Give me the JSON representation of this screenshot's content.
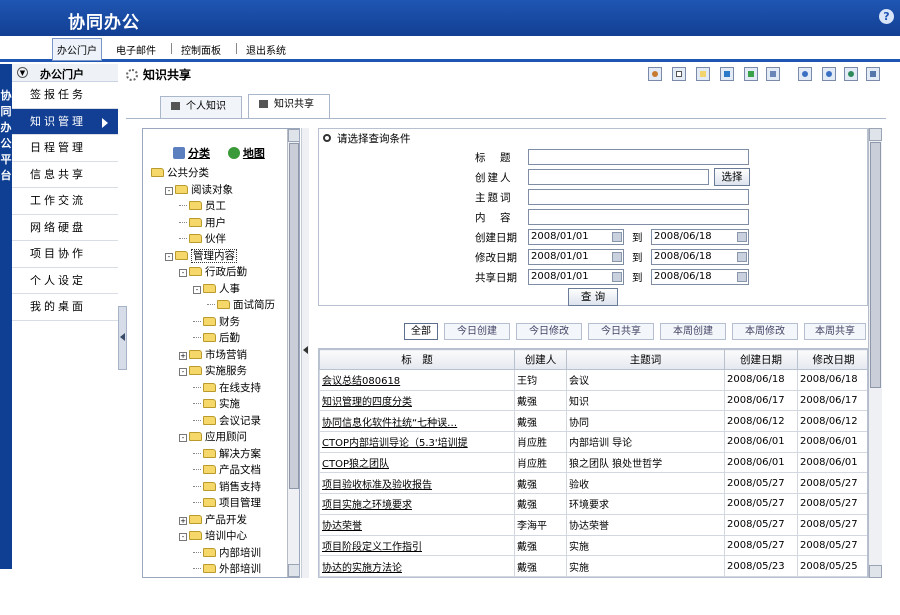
{
  "app": {
    "title": "协同办公"
  },
  "menu": [
    {
      "label": "办公门户",
      "active": true
    },
    {
      "label": "电子邮件"
    },
    {
      "label": "控制面板"
    },
    {
      "label": "退出系统"
    }
  ],
  "strip_text": "协同办公平台",
  "nav": {
    "header": "办公门户",
    "items": [
      {
        "label": "签报任务"
      },
      {
        "label": "知识管理",
        "active": true
      },
      {
        "label": "日程管理"
      },
      {
        "label": "信息共享"
      },
      {
        "label": "工作交流"
      },
      {
        "label": "网络硬盘"
      },
      {
        "label": "项目协作"
      },
      {
        "label": "个人设定"
      },
      {
        "label": "我的桌面"
      }
    ]
  },
  "page": {
    "title": "知识共享"
  },
  "toolbar_icons": [
    "user-icon",
    "document-icon",
    "copy-icon",
    "monitor-icon",
    "edit-icon",
    "back-icon",
    "prev-icon",
    "next-icon",
    "refresh-icon",
    "settings-icon"
  ],
  "tabs": [
    {
      "label": "个人知识"
    },
    {
      "label": "知识共享",
      "active": true
    }
  ],
  "tree": {
    "top_links": [
      "分类",
      "地图"
    ],
    "nodes": [
      {
        "label": "公共分类",
        "level": 0,
        "exp": ""
      },
      {
        "label": "阅读对象",
        "level": 1,
        "exp": "-"
      },
      {
        "label": "员工",
        "level": 2,
        "exp": ""
      },
      {
        "label": "用户",
        "level": 2,
        "exp": ""
      },
      {
        "label": "伙伴",
        "level": 2,
        "exp": ""
      },
      {
        "label": "管理内容",
        "level": 1,
        "exp": "-",
        "sel": true
      },
      {
        "label": "行政后勤",
        "level": 2,
        "exp": "-"
      },
      {
        "label": "人事",
        "level": 3,
        "exp": "-"
      },
      {
        "label": "面试简历",
        "level": 4,
        "exp": ""
      },
      {
        "label": "财务",
        "level": 3,
        "exp": ""
      },
      {
        "label": "后勤",
        "level": 3,
        "exp": ""
      },
      {
        "label": "市场营销",
        "level": 2,
        "exp": "+"
      },
      {
        "label": "实施服务",
        "level": 2,
        "exp": "-"
      },
      {
        "label": "在线支持",
        "level": 3,
        "exp": ""
      },
      {
        "label": "实施",
        "level": 3,
        "exp": ""
      },
      {
        "label": "会议记录",
        "level": 3,
        "exp": ""
      },
      {
        "label": "应用顾问",
        "level": 2,
        "exp": "-"
      },
      {
        "label": "解决方案",
        "level": 3,
        "exp": ""
      },
      {
        "label": "产品文档",
        "level": 3,
        "exp": ""
      },
      {
        "label": "销售支持",
        "level": 3,
        "exp": ""
      },
      {
        "label": "项目管理",
        "level": 3,
        "exp": ""
      },
      {
        "label": "产品开发",
        "level": 2,
        "exp": "+"
      },
      {
        "label": "培训中心",
        "level": 2,
        "exp": "-"
      },
      {
        "label": "内部培训",
        "level": 3,
        "exp": ""
      },
      {
        "label": "外部培训",
        "level": 3,
        "exp": ""
      }
    ]
  },
  "query": {
    "header": "请选择查询条件",
    "fields": {
      "title_label": "标　题",
      "creator_label": "创建人",
      "topic_label": "主题词",
      "content_label": "内　容",
      "created_label": "创建日期",
      "modified_label": "修改日期",
      "shared_label": "共享日期",
      "to_label": "到",
      "select_button": "选择",
      "query_button": "查 询",
      "created_from": "2008/01/01",
      "created_to": "2008/06/18",
      "modified_from": "2008/01/01",
      "modified_to": "2008/06/18",
      "shared_from": "2008/01/01",
      "shared_to": "2008/06/18"
    }
  },
  "filters": [
    {
      "label": "全部",
      "active": true
    },
    {
      "label": "今日创建"
    },
    {
      "label": "今日修改"
    },
    {
      "label": "今日共享"
    },
    {
      "label": "本周创建"
    },
    {
      "label": "本周修改"
    },
    {
      "label": "本周共享"
    }
  ],
  "grid": {
    "columns": [
      "标　题",
      "创建人",
      "主题词",
      "创建日期",
      "修改日期"
    ],
    "rows": [
      [
        "会议总结080618",
        "王钧",
        "会议",
        "2008/06/18",
        "2008/06/18"
      ],
      [
        "知识管理的四度分类",
        "戴强",
        "知识",
        "2008/06/17",
        "2008/06/17"
      ],
      [
        "协同信息化软件社统“七种误…",
        "戴强",
        "协同",
        "2008/06/12",
        "2008/06/12"
      ],
      [
        "CTOP内部培训导论（5.3'培训提",
        "肖应胜",
        "内部培训 导论",
        "2008/06/01",
        "2008/06/01"
      ],
      [
        "CTOP狼之团队",
        "肖应胜",
        "狼之团队 狼处世哲学",
        "2008/06/01",
        "2008/06/01"
      ],
      [
        "项目验收标准及验收报告",
        "戴强",
        "验收",
        "2008/05/27",
        "2008/05/27"
      ],
      [
        "项目实施之环境要求",
        "戴强",
        "环境要求",
        "2008/05/27",
        "2008/05/27"
      ],
      [
        "协达荣誉",
        "李海平",
        "协达荣誉",
        "2008/05/27",
        "2008/05/27"
      ],
      [
        "项目阶段定义工作指引",
        "戴强",
        "实施",
        "2008/05/27",
        "2008/05/27"
      ],
      [
        "协达的实施方法论",
        "戴强",
        "实施",
        "2008/05/23",
        "2008/05/25"
      ]
    ]
  }
}
